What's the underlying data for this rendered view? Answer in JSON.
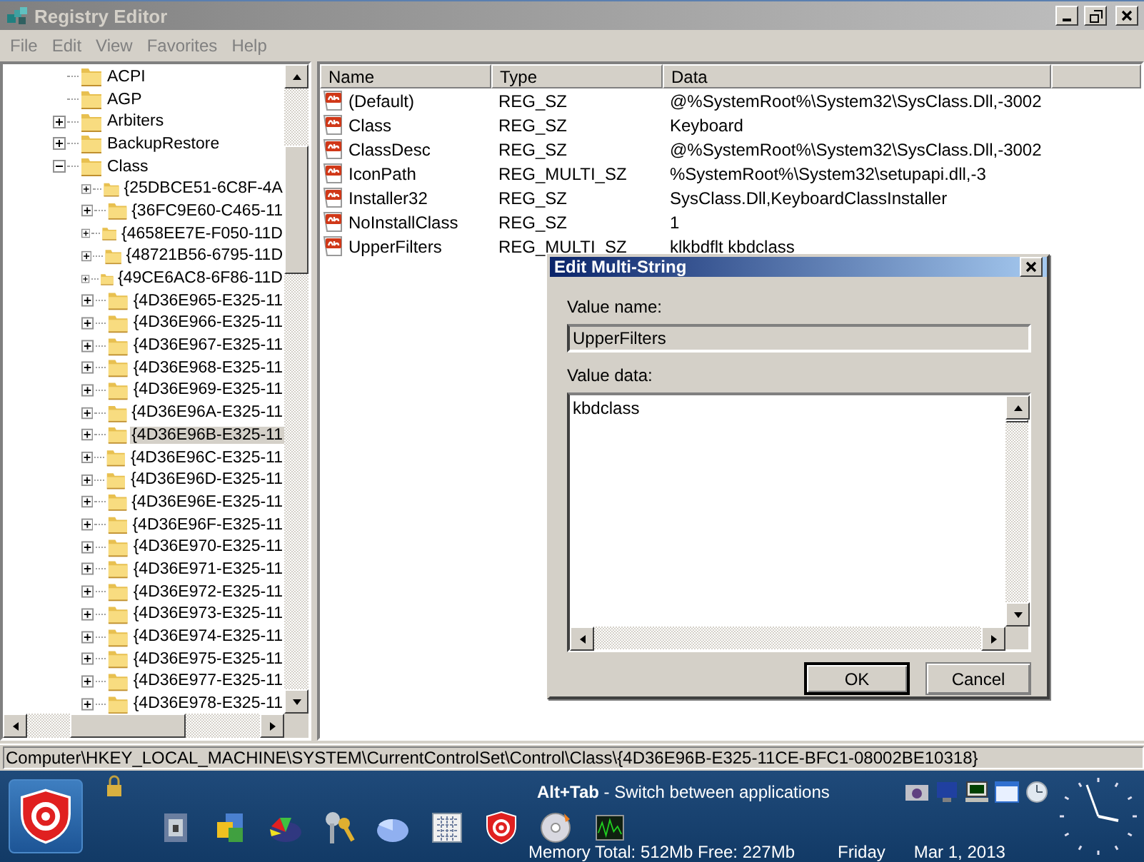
{
  "window": {
    "title": "Registry Editor"
  },
  "menu": [
    "File",
    "Edit",
    "View",
    "Favorites",
    "Help"
  ],
  "tree": [
    {
      "label": "ACPI",
      "kind": "leaf",
      "selected": false
    },
    {
      "label": "AGP",
      "kind": "leaf",
      "selected": false
    },
    {
      "label": "Arbiters",
      "kind": "node",
      "expanded": false,
      "selected": false
    },
    {
      "label": "BackupRestore",
      "kind": "node",
      "expanded": false,
      "selected": false
    },
    {
      "label": "Class",
      "kind": "node",
      "expanded": true,
      "selected": false,
      "children": [
        {
          "label": "{25DBCE51-6C8F-4A",
          "kind": "node",
          "expanded": false,
          "selected": false
        },
        {
          "label": "{36FC9E60-C465-11",
          "kind": "node",
          "expanded": false,
          "selected": false
        },
        {
          "label": "{4658EE7E-F050-11D",
          "kind": "node",
          "expanded": false,
          "selected": false
        },
        {
          "label": "{48721B56-6795-11D",
          "kind": "node",
          "expanded": false,
          "selected": false
        },
        {
          "label": "{49CE6AC8-6F86-11D",
          "kind": "node",
          "expanded": false,
          "selected": false
        },
        {
          "label": "{4D36E965-E325-11",
          "kind": "node",
          "expanded": false,
          "selected": false
        },
        {
          "label": "{4D36E966-E325-11",
          "kind": "node",
          "expanded": false,
          "selected": false
        },
        {
          "label": "{4D36E967-E325-11",
          "kind": "node",
          "expanded": false,
          "selected": false
        },
        {
          "label": "{4D36E968-E325-11",
          "kind": "node",
          "expanded": false,
          "selected": false
        },
        {
          "label": "{4D36E969-E325-11",
          "kind": "node",
          "expanded": false,
          "selected": false
        },
        {
          "label": "{4D36E96A-E325-11",
          "kind": "node",
          "expanded": false,
          "selected": false
        },
        {
          "label": "{4D36E96B-E325-11",
          "kind": "node",
          "expanded": false,
          "selected": true
        },
        {
          "label": "{4D36E96C-E325-11",
          "kind": "node",
          "expanded": false,
          "selected": false
        },
        {
          "label": "{4D36E96D-E325-11",
          "kind": "node",
          "expanded": false,
          "selected": false
        },
        {
          "label": "{4D36E96E-E325-11",
          "kind": "node",
          "expanded": false,
          "selected": false
        },
        {
          "label": "{4D36E96F-E325-11",
          "kind": "node",
          "expanded": false,
          "selected": false
        },
        {
          "label": "{4D36E970-E325-11",
          "kind": "node",
          "expanded": false,
          "selected": false
        },
        {
          "label": "{4D36E971-E325-11",
          "kind": "node",
          "expanded": false,
          "selected": false
        },
        {
          "label": "{4D36E972-E325-11",
          "kind": "node",
          "expanded": false,
          "selected": false
        },
        {
          "label": "{4D36E973-E325-11",
          "kind": "node",
          "expanded": false,
          "selected": false
        },
        {
          "label": "{4D36E974-E325-11",
          "kind": "node",
          "expanded": false,
          "selected": false
        },
        {
          "label": "{4D36E975-E325-11",
          "kind": "node",
          "expanded": false,
          "selected": false
        },
        {
          "label": "{4D36E977-E325-11",
          "kind": "node",
          "expanded": false,
          "selected": false
        },
        {
          "label": "{4D36E978-E325-11",
          "kind": "node",
          "expanded": false,
          "selected": false
        }
      ]
    }
  ],
  "list": {
    "columns": [
      "Name",
      "Type",
      "Data"
    ],
    "rows": [
      {
        "name": "(Default)",
        "type": "REG_SZ",
        "data": "@%SystemRoot%\\System32\\SysClass.Dll,-3002"
      },
      {
        "name": "Class",
        "type": "REG_SZ",
        "data": "Keyboard"
      },
      {
        "name": "ClassDesc",
        "type": "REG_SZ",
        "data": "@%SystemRoot%\\System32\\SysClass.Dll,-3002"
      },
      {
        "name": "IconPath",
        "type": "REG_MULTI_SZ",
        "data": "%SystemRoot%\\System32\\setupapi.dll,-3"
      },
      {
        "name": "Installer32",
        "type": "REG_SZ",
        "data": "SysClass.Dll,KeyboardClassInstaller"
      },
      {
        "name": "NoInstallClass",
        "type": "REG_SZ",
        "data": "1"
      },
      {
        "name": "UpperFilters",
        "type": "REG_MULTI_SZ",
        "data": "klkbdflt kbdclass"
      }
    ]
  },
  "dialog": {
    "title": "Edit Multi-String",
    "name_label": "Value name:",
    "name_value": "UpperFilters",
    "data_label": "Value data:",
    "data_value": "kbdclass",
    "buttons": [
      {
        "label": "OK",
        "default": true
      },
      {
        "label": "Cancel",
        "default": false
      }
    ]
  },
  "status_bar": "Computer\\HKEY_LOCAL_MACHINE\\SYSTEM\\CurrentControlSet\\Control\\Class\\{4D36E96B-E325-11CE-BFC1-08002BE10318}",
  "taskbar": {
    "hint": "**Alt+Tab** - Switch between applications",
    "memory": "Memory Total: 512Mb Free: 227Mb",
    "day": "Friday",
    "date": "Mar 1, 2013"
  }
}
